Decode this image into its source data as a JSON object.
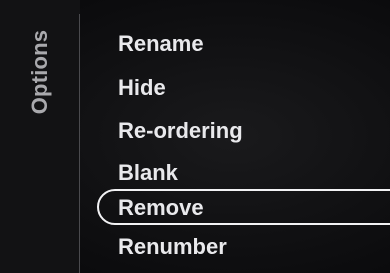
{
  "panel": {
    "title": "Options"
  },
  "menu": {
    "items": [
      {
        "label": "Rename"
      },
      {
        "label": "Hide"
      },
      {
        "label": "Re-ordering"
      },
      {
        "label": "Blank"
      },
      {
        "label": "Remove",
        "selected": true
      },
      {
        "label": "Renumber"
      }
    ]
  },
  "colors": {
    "background": "#0f0f11",
    "text": "#e9e9ec",
    "panel_title": "#a9a9ad",
    "focus_ring": "#f2f2f4"
  }
}
